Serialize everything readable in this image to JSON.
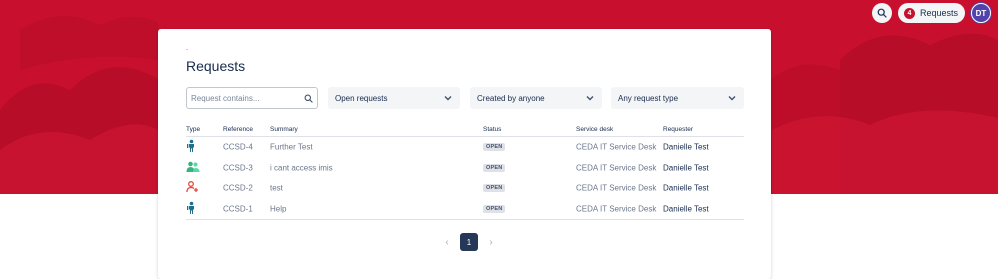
{
  "colors": {
    "brand": "#c8102e",
    "avatar": "#5243aa",
    "current_page": "#253858"
  },
  "topbar": {
    "search_icon": "search-icon",
    "requests_count": "4",
    "requests_label": "Requests",
    "avatar_initials": "DT"
  },
  "breadcrumb": ".",
  "page_title": "Requests",
  "filters": {
    "search_placeholder": "Request contains...",
    "status": "Open requests",
    "created_by": "Created by anyone",
    "request_type": "Any request type"
  },
  "table": {
    "headers": {
      "type": "Type",
      "reference": "Reference",
      "summary": "Summary",
      "status": "Status",
      "service_desk": "Service desk",
      "requester": "Requester"
    },
    "rows": [
      {
        "type_icon": "person-standing-icon",
        "reference": "CCSD-4",
        "summary": "Further Test",
        "status": "OPEN",
        "service_desk": "CEDA IT Service Desk",
        "requester": "Danielle Test"
      },
      {
        "type_icon": "people-icon",
        "reference": "CCSD-3",
        "summary": "i cant access imis",
        "status": "OPEN",
        "service_desk": "CEDA IT Service Desk",
        "requester": "Danielle Test"
      },
      {
        "type_icon": "add-user-icon",
        "reference": "CCSD-2",
        "summary": "test",
        "status": "OPEN",
        "service_desk": "CEDA IT Service Desk",
        "requester": "Danielle Test"
      },
      {
        "type_icon": "person-standing-icon",
        "reference": "CCSD-1",
        "summary": "Help",
        "status": "OPEN",
        "service_desk": "CEDA IT Service Desk",
        "requester": "Danielle Test"
      }
    ]
  },
  "pagination": {
    "current_page": "1",
    "prev_icon": "chevron-left-icon",
    "next_icon": "chevron-right-icon"
  }
}
